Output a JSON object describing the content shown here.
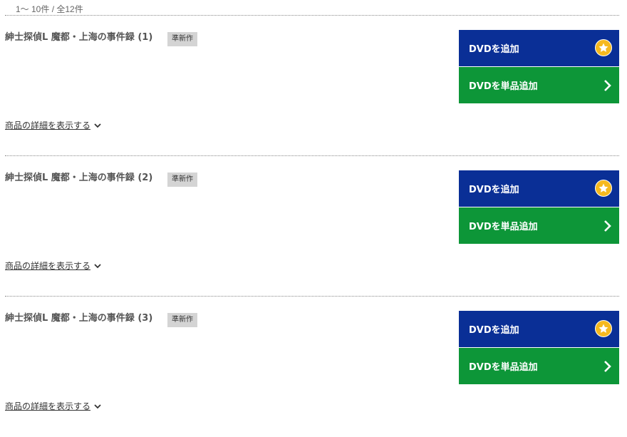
{
  "pagination": {
    "count_text": "1〜 10件 / 全12件"
  },
  "items": [
    {
      "title": "紳士探偵L 魔都・上海の事件録 (1)",
      "badge": "準新作",
      "add_label": "DVDを追加",
      "single_add_label": "DVDを単品追加",
      "details_label": "商品の詳細を表示する"
    },
    {
      "title": "紳士探偵L 魔都・上海の事件録 (2)",
      "badge": "準新作",
      "add_label": "DVDを追加",
      "single_add_label": "DVDを単品追加",
      "details_label": "商品の詳細を表示する"
    },
    {
      "title": "紳士探偵L 魔都・上海の事件録 (3)",
      "badge": "準新作",
      "add_label": "DVDを追加",
      "single_add_label": "DVDを単品追加",
      "details_label": "商品の詳細を表示する"
    }
  ],
  "colors": {
    "add_button": "#0a2f96",
    "single_add_button": "#0d9638",
    "star": "#f6b91f",
    "badge": "#d4d4d4"
  },
  "icons": {
    "add": "star-icon",
    "single_add": "chevron-right-icon",
    "details": "chevron-down-icon"
  }
}
